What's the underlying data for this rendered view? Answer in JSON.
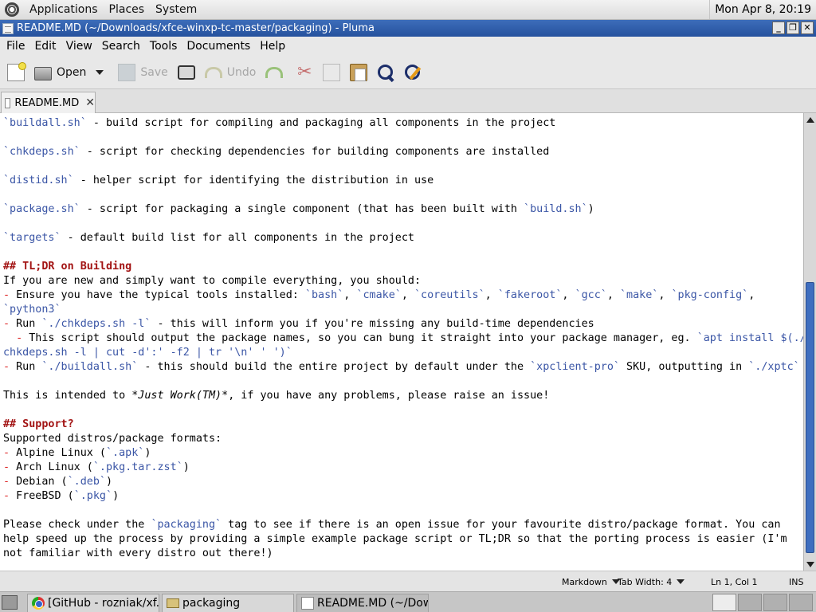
{
  "top_panel": {
    "menus": [
      "Applications",
      "Places",
      "System"
    ],
    "clock": "Mon Apr 8, 20:19"
  },
  "window": {
    "title": "README.MD (~/Downloads/xfce-winxp-tc-master/packaging) - Pluma",
    "buttons": [
      "_",
      "❐",
      "✕"
    ]
  },
  "menubar": [
    "File",
    "Edit",
    "View",
    "Search",
    "Tools",
    "Documents",
    "Help"
  ],
  "toolbar": {
    "open_label": "Open",
    "save_label": "Save",
    "undo_label": "Undo"
  },
  "tab": {
    "label": "README.MD",
    "close": "✕"
  },
  "editor": {
    "lines": [
      [
        [
          "c",
          "`buildall.sh`"
        ],
        [
          "t",
          " - build script for compiling and packaging all components in the project"
        ]
      ],
      [],
      [
        [
          "c",
          "`chkdeps.sh`"
        ],
        [
          "t",
          " - script for checking dependencies for building components are installed"
        ]
      ],
      [],
      [
        [
          "c",
          "`distid.sh`"
        ],
        [
          "t",
          " - helper script for identifying the distribution in use"
        ]
      ],
      [],
      [
        [
          "c",
          "`package.sh`"
        ],
        [
          "t",
          " - script for packaging a single component (that has been built with "
        ],
        [
          "c",
          "`build.sh`"
        ],
        [
          "t",
          ")"
        ]
      ],
      [],
      [
        [
          "c",
          "`targets`"
        ],
        [
          "t",
          " - default build list for all components in the project"
        ]
      ],
      [],
      [
        [
          "h",
          "## TL;DR on Building"
        ]
      ],
      [
        [
          "t",
          "If you are new and simply want to compile everything, you should:"
        ]
      ],
      [
        [
          "l",
          "-"
        ],
        [
          "t",
          " Ensure you have the typical tools installed: "
        ],
        [
          "c",
          "`bash`"
        ],
        [
          "t",
          ", "
        ],
        [
          "c",
          "`cmake`"
        ],
        [
          "t",
          ", "
        ],
        [
          "c",
          "`coreutils`"
        ],
        [
          "t",
          ", "
        ],
        [
          "c",
          "`fakeroot`"
        ],
        [
          "t",
          ", "
        ],
        [
          "c",
          "`gcc`"
        ],
        [
          "t",
          ", "
        ],
        [
          "c",
          "`make`"
        ],
        [
          "t",
          ", "
        ],
        [
          "c",
          "`pkg-config`"
        ],
        [
          "t",
          ","
        ]
      ],
      [
        [
          "c",
          "`python3`"
        ]
      ],
      [
        [
          "l",
          "-"
        ],
        [
          "t",
          " Run "
        ],
        [
          "c",
          "`./chkdeps.sh -l`"
        ],
        [
          "t",
          " - this will inform you if you're missing any build-time dependencies"
        ]
      ],
      [
        [
          "t",
          "  "
        ],
        [
          "l",
          "-"
        ],
        [
          "t",
          " This script should output the package names, so you can bung it straight into your package manager, eg. "
        ],
        [
          "c",
          "`apt install $(./"
        ]
      ],
      [
        [
          "c",
          "chkdeps.sh -l | cut -d':' -f2 | tr '\\n' ' ')`"
        ]
      ],
      [
        [
          "l",
          "-"
        ],
        [
          "t",
          " Run "
        ],
        [
          "c",
          "`./buildall.sh`"
        ],
        [
          "t",
          " - this should build the entire project by default under the "
        ],
        [
          "c",
          "`xpclient-pro`"
        ],
        [
          "t",
          " SKU, outputting in "
        ],
        [
          "c",
          "`./xptc`"
        ]
      ],
      [],
      [
        [
          "t",
          "This is intended to "
        ],
        [
          "e",
          "*Just Work(TM)*"
        ],
        [
          "t",
          ", if you have any problems, please raise an issue!"
        ]
      ],
      [],
      [
        [
          "h",
          "## Support?"
        ]
      ],
      [
        [
          "t",
          "Supported distros/package formats:"
        ]
      ],
      [
        [
          "l",
          "-"
        ],
        [
          "t",
          " Alpine Linux ("
        ],
        [
          "c",
          "`.apk`"
        ],
        [
          "t",
          ")"
        ]
      ],
      [
        [
          "l",
          "-"
        ],
        [
          "t",
          " Arch Linux ("
        ],
        [
          "c",
          "`.pkg.tar.zst`"
        ],
        [
          "t",
          ")"
        ]
      ],
      [
        [
          "l",
          "-"
        ],
        [
          "t",
          " Debian ("
        ],
        [
          "c",
          "`.deb`"
        ],
        [
          "t",
          ")"
        ]
      ],
      [
        [
          "l",
          "-"
        ],
        [
          "t",
          " FreeBSD ("
        ],
        [
          "c",
          "`.pkg`"
        ],
        [
          "t",
          ")"
        ]
      ],
      [],
      [
        [
          "t",
          "Please check under the "
        ],
        [
          "c",
          "`packaging`"
        ],
        [
          "t",
          " tag to see if there is an open issue for your favourite distro/package format. You can"
        ]
      ],
      [
        [
          "t",
          "help speed up the process by providing a simple example package script or TL;DR so that the porting process is easier (I'm"
        ]
      ],
      [
        [
          "t",
          "not familiar with every distro out there!)"
        ]
      ]
    ]
  },
  "statusbar": {
    "language": "Markdown",
    "tab_width": "Tab Width:  4",
    "position": "Ln 1, Col 1",
    "mode": "INS"
  },
  "taskbar": {
    "tasks": [
      "[GitHub - rozniak/xf...",
      "packaging",
      "README.MD (~/Dow..."
    ]
  },
  "colors": {
    "code": "#3b56a6",
    "heading": "#a21313",
    "list_marker": "#dd2222",
    "titlebar": "#2f5da8",
    "scroll_thumb": "#3f6ebf"
  }
}
